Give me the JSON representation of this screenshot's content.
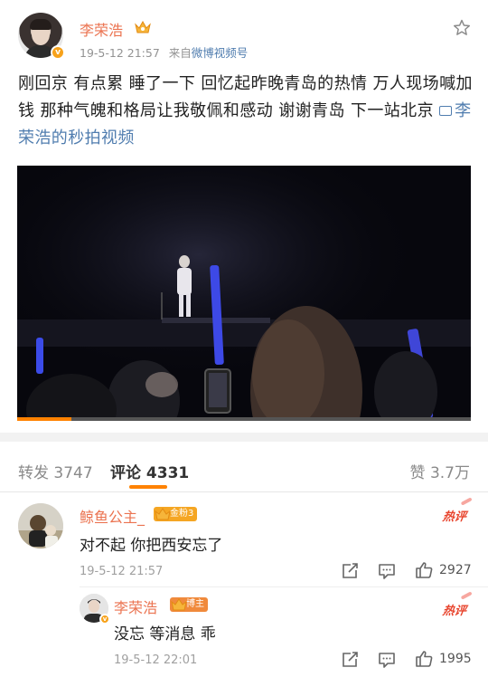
{
  "post": {
    "author": "李荣浩",
    "timestamp": "19-5-12 21:57",
    "source_prefix": "来自",
    "source": "微博视频号",
    "text": "刚回京 有点累 睡了一下 回忆起昨晚青岛的热情 万人现场喊加钱 那种气魄和格局让我敬佩和感动 谢谢青岛 下一站北京 ",
    "video_link_text": "李荣浩的秒拍视频",
    "icons": [
      "verified-badge-icon",
      "crown-icon",
      "star-icon",
      "video-link-icon"
    ]
  },
  "video": {
    "progress_fraction": 0.12,
    "colors": {
      "background": "#06060c",
      "progress": "#ff8200"
    }
  },
  "tabs": {
    "forward": "转发 3747",
    "comment": "评论 4331",
    "like": "赞 3.7万"
  },
  "comments": [
    {
      "author": "鲸鱼公主_",
      "badge": "金粉3",
      "text": "对不起 你把西安忘了",
      "time": "19-5-12 21:57",
      "hot_label": "热评",
      "likes": "2927"
    },
    {
      "author": "李荣浩",
      "badge": "博主",
      "text": "没忘 等消息 乖",
      "time": "19-5-12 22:01",
      "hot_label": "热评",
      "likes": "1995"
    }
  ],
  "colors": {
    "username": "#eb7350",
    "link": "#507daf",
    "accent": "#ff8200",
    "hot": "#e8452e"
  }
}
